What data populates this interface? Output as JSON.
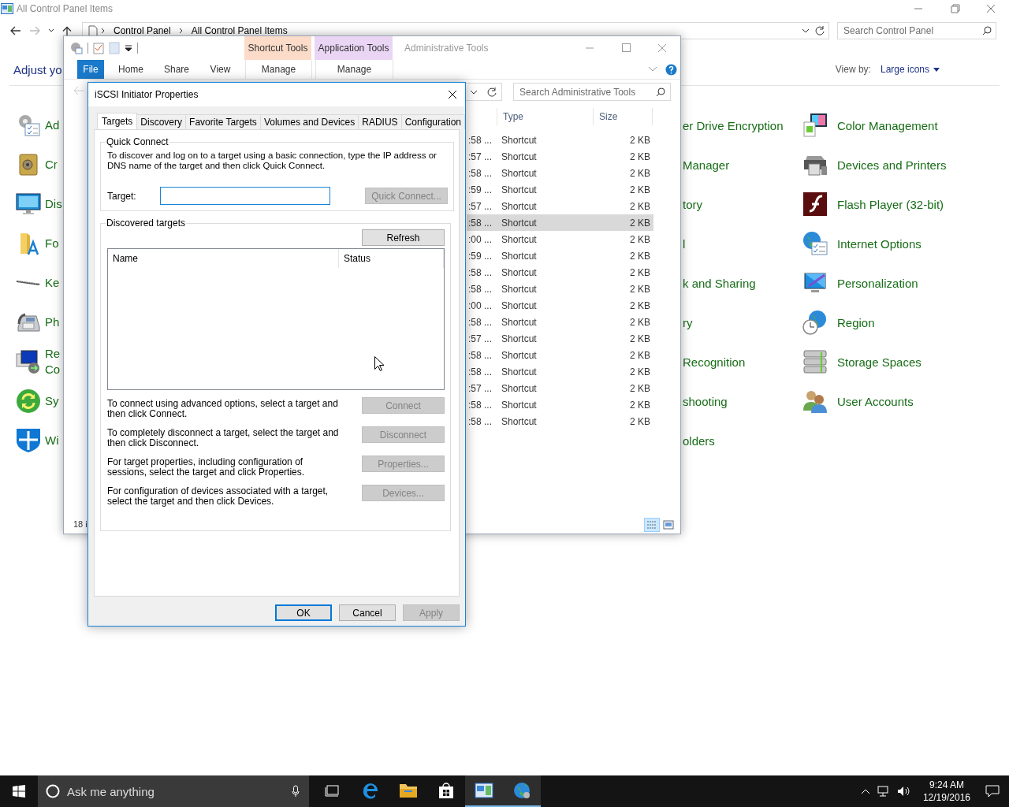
{
  "control_panel": {
    "title": "All Control Panel Items",
    "breadcrumb": [
      "Control Panel",
      "All Control Panel Items"
    ],
    "search": {
      "placeholder": "Search Control Panel"
    },
    "heading": "Adjust yo",
    "view_by": {
      "label": "View by:",
      "value": "Large icons"
    },
    "items_left": [
      {
        "label": "Ad"
      },
      {
        "label": "Cr"
      },
      {
        "label": "Dis"
      },
      {
        "label": "Fo"
      },
      {
        "label": "Ke"
      },
      {
        "label": "Ph"
      },
      {
        "label": "Re Co"
      },
      {
        "label": "Sy"
      },
      {
        "label": "Wi"
      }
    ],
    "items_middle": [
      {
        "label": "er Drive Encryption"
      },
      {
        "label": "Manager"
      },
      {
        "label": "tory"
      },
      {
        "label": "l"
      },
      {
        "label": "k and Sharing"
      },
      {
        "label": "ry"
      },
      {
        "label": "Recognition"
      },
      {
        "label": "shooting"
      },
      {
        "label": "olders"
      }
    ],
    "items_right": [
      {
        "label": "Color Management"
      },
      {
        "label": "Devices and Printers"
      },
      {
        "label": "Flash Player (32-bit)"
      },
      {
        "label": "Internet Options"
      },
      {
        "label": "Personalization"
      },
      {
        "label": "Region"
      },
      {
        "label": "Storage Spaces"
      },
      {
        "label": "User Accounts"
      }
    ]
  },
  "admin_window": {
    "title": "Administrative Tools",
    "context_groups": [
      {
        "label": "Shortcut Tools",
        "tab": "Manage",
        "color": "#fcdcc8"
      },
      {
        "label": "Application Tools",
        "tab": "Manage",
        "color": "#ead5f5"
      }
    ],
    "ribbon_tabs": [
      {
        "label": "File",
        "kind": "file_menu"
      },
      {
        "label": "Home",
        "kind": "tab"
      },
      {
        "label": "Share",
        "kind": "tab"
      },
      {
        "label": "View",
        "kind": "tab"
      }
    ],
    "search": {
      "placeholder": "Search Administrative Tools"
    },
    "columns": [
      "Type",
      "Size"
    ],
    "rows": [
      {
        "date": ":58 ...",
        "type": "Shortcut",
        "size": "2 KB",
        "selected": false
      },
      {
        "date": ":57 ...",
        "type": "Shortcut",
        "size": "2 KB",
        "selected": false
      },
      {
        "date": ":58 ...",
        "type": "Shortcut",
        "size": "2 KB",
        "selected": false
      },
      {
        "date": ":59 ...",
        "type": "Shortcut",
        "size": "2 KB",
        "selected": false
      },
      {
        "date": ":57 ...",
        "type": "Shortcut",
        "size": "2 KB",
        "selected": false
      },
      {
        "date": ":58 ...",
        "type": "Shortcut",
        "size": "2 KB",
        "selected": true
      },
      {
        "date": ":00 ...",
        "type": "Shortcut",
        "size": "2 KB",
        "selected": false
      },
      {
        "date": ":59 ...",
        "type": "Shortcut",
        "size": "2 KB",
        "selected": false
      },
      {
        "date": ":58 ...",
        "type": "Shortcut",
        "size": "2 KB",
        "selected": false
      },
      {
        "date": ":58 ...",
        "type": "Shortcut",
        "size": "2 KB",
        "selected": false
      },
      {
        "date": ":00 ...",
        "type": "Shortcut",
        "size": "2 KB",
        "selected": false
      },
      {
        "date": ":58 ...",
        "type": "Shortcut",
        "size": "2 KB",
        "selected": false
      },
      {
        "date": ":57 ...",
        "type": "Shortcut",
        "size": "2 KB",
        "selected": false
      },
      {
        "date": ":58 ...",
        "type": "Shortcut",
        "size": "2 KB",
        "selected": false
      },
      {
        "date": ":58 ...",
        "type": "Shortcut",
        "size": "2 KB",
        "selected": false
      },
      {
        "date": ":57 ...",
        "type": "Shortcut",
        "size": "2 KB",
        "selected": false
      },
      {
        "date": ":58 ...",
        "type": "Shortcut",
        "size": "2 KB",
        "selected": false
      },
      {
        "date": ":58 ...",
        "type": "Shortcut",
        "size": "2 KB",
        "selected": false
      }
    ],
    "status": "18 i"
  },
  "dialog": {
    "title": "iSCSI Initiator Properties",
    "tabs": [
      {
        "label": "Targets",
        "selected": true
      },
      {
        "label": "Discovery",
        "selected": false
      },
      {
        "label": "Favorite Targets",
        "selected": false
      },
      {
        "label": "Volumes and Devices",
        "selected": false
      },
      {
        "label": "RADIUS",
        "selected": false
      },
      {
        "label": "Configuration",
        "selected": false
      }
    ],
    "quick_connect": {
      "title": "Quick Connect",
      "text": "To discover and log on to a target using a basic connection, type the IP address or DNS name of the target and then click Quick Connect.",
      "target_label": "Target:",
      "button": {
        "label": "Quick Connect...",
        "disabled": true
      }
    },
    "discovered": {
      "title": "Discovered targets",
      "refresh": {
        "label": "Refresh",
        "disabled": false
      },
      "columns": [
        "Name",
        "Status"
      ],
      "actions": [
        {
          "text": "To connect using advanced options, select a target and then click Connect.",
          "button": {
            "label": "Connect",
            "disabled": true
          }
        },
        {
          "text": "To completely disconnect a target, select the target and then click Disconnect.",
          "button": {
            "label": "Disconnect",
            "disabled": true
          }
        },
        {
          "text": "For target properties, including configuration of sessions, select the target and click Properties.",
          "button": {
            "label": "Properties...",
            "disabled": true
          }
        },
        {
          "text": "For configuration of devices associated with a target, select the target and then click Devices.",
          "button": {
            "label": "Devices...",
            "disabled": true
          }
        }
      ]
    },
    "buttons": [
      {
        "label": "OK",
        "default": true,
        "disabled": false
      },
      {
        "label": "Cancel",
        "default": false,
        "disabled": false
      },
      {
        "label": "Apply",
        "default": false,
        "disabled": true
      }
    ]
  },
  "taskbar": {
    "search_placeholder": "Ask me anything",
    "apps": [
      {
        "active": false
      },
      {
        "active": false
      },
      {
        "active": false
      },
      {
        "active": false
      },
      {
        "active": true
      },
      {
        "active": true
      }
    ],
    "clock": {
      "time": "9:24 AM",
      "date": "12/19/2016"
    }
  }
}
